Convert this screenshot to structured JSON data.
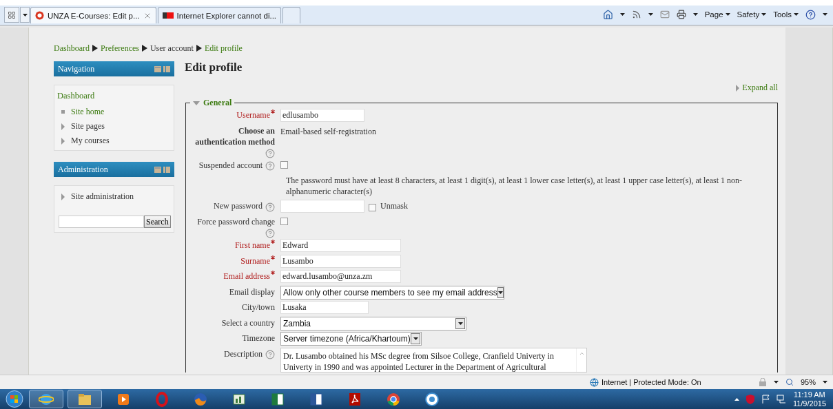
{
  "browser": {
    "tabs": [
      {
        "title": "UNZA E-Courses: Edit p...",
        "selected": true,
        "closable": true
      },
      {
        "title": "Internet Explorer cannot di...",
        "selected": false,
        "closable": false
      }
    ],
    "menus": [
      "Page",
      "Safety",
      "Tools"
    ]
  },
  "breadcrumb": [
    {
      "label": "Dashboard",
      "link": true
    },
    {
      "label": "Preferences",
      "link": true
    },
    {
      "label": "User account",
      "link": false
    },
    {
      "label": "Edit profile",
      "link": true
    }
  ],
  "blocks": [
    {
      "title": "Navigation",
      "heading": "Dashboard",
      "items": [
        {
          "label": "Site home",
          "kind": "leaf"
        },
        {
          "label": "Site pages",
          "kind": "branch"
        },
        {
          "label": "My courses",
          "kind": "branch"
        }
      ]
    },
    {
      "title": "Administration",
      "items": [
        {
          "label": "Site administration",
          "kind": "branch"
        }
      ],
      "search_button": "Search"
    }
  ],
  "page": {
    "title": "Edit profile",
    "expand_all": "Expand all",
    "section": {
      "legend": "General",
      "expanded": true,
      "fields": [
        {
          "kind": "text",
          "label": "Username",
          "required": true,
          "help": false,
          "value": "edlusambo"
        },
        {
          "kind": "static",
          "label": "Choose an authentication method",
          "required": false,
          "help": true,
          "value": "Email-based self-registration"
        },
        {
          "kind": "checkbox",
          "label": "Suspended account",
          "required": false,
          "help": true,
          "checked": false
        },
        {
          "kind": "note",
          "value": "The password must have at least 8 characters, at least 1 digit(s), at least 1 lower case letter(s), at least 1 upper case letter(s), at least 1 non-alphanumeric character(s)"
        },
        {
          "kind": "password",
          "label": "New password",
          "required": false,
          "help": true,
          "unmask": {
            "label": "Unmask",
            "checked": false
          }
        },
        {
          "kind": "checkbox",
          "label": "Force password change",
          "required": false,
          "help": true,
          "checked": false
        },
        {
          "kind": "text",
          "label": "First name",
          "required": true,
          "help": false,
          "value": "Edward"
        },
        {
          "kind": "text",
          "label": "Surname",
          "required": true,
          "help": false,
          "value": "Lusambo"
        },
        {
          "kind": "text",
          "label": "Email address",
          "required": true,
          "help": false,
          "value": "edward.lusambo@unza.zm"
        },
        {
          "kind": "select",
          "label": "Email display",
          "required": false,
          "help": false,
          "value": "Allow only other course members to see my email address"
        },
        {
          "kind": "text",
          "label": "City/town",
          "required": false,
          "help": false,
          "value": "Lusaka"
        },
        {
          "kind": "select",
          "label": "Select a country",
          "required": false,
          "help": false,
          "value": "Zambia"
        },
        {
          "kind": "select",
          "label": "Timezone",
          "required": false,
          "help": false,
          "value": "Server timezone (Africa/Khartoum)"
        },
        {
          "kind": "textarea",
          "label": "Description",
          "required": false,
          "help": true,
          "value": "Dr. Lusambo obtained his MSc degree from Silsoe College, Cranfield Univerty in Univerty in 1990 and was appointed Lecturer in the Department of Agricultural"
        }
      ]
    }
  },
  "status_bar": {
    "zone": "Internet | Protected Mode: On",
    "zoom": "95%"
  },
  "clock": {
    "time": "11:19 AM",
    "date": "11/9/2015"
  }
}
